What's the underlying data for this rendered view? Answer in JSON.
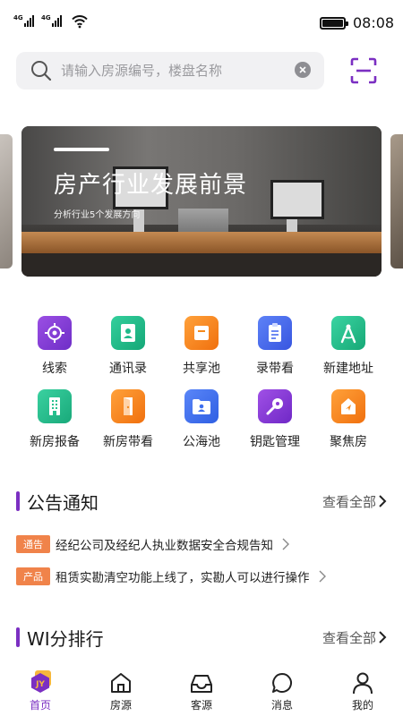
{
  "status_bar": {
    "signal_1": "4G",
    "signal_2": "4G",
    "time": "08:08"
  },
  "search": {
    "placeholder": "请输入房源编号，楼盘名称"
  },
  "banner": {
    "title": "房产行业发展前景",
    "subtitle": "分析行业5个发展方向"
  },
  "quick_actions": [
    {
      "label": "线索",
      "icon": "target-icon",
      "color": "#8a3ed6"
    },
    {
      "label": "通讯录",
      "icon": "contacts-icon",
      "color": "#1fb98a"
    },
    {
      "label": "共享池",
      "icon": "share-box-icon",
      "color": "#f5891f"
    },
    {
      "label": "录带看",
      "icon": "clipboard-icon",
      "color": "#4a6cf0"
    },
    {
      "label": "新建地址",
      "icon": "compass-icon",
      "color": "#22c08f"
    },
    {
      "label": "新房报备",
      "icon": "building-icon",
      "color": "#27c08e"
    },
    {
      "label": "新房带看",
      "icon": "door-icon",
      "color": "#f58a1c"
    },
    {
      "label": "公海池",
      "icon": "folder-user-icon",
      "color": "#3d6ff0"
    },
    {
      "label": "钥匙管理",
      "icon": "key-icon",
      "color": "#8b3ad6"
    },
    {
      "label": "聚焦房",
      "icon": "focus-house-icon",
      "color": "#f58a1c"
    }
  ],
  "announcements": {
    "title": "公告通知",
    "more": "查看全部",
    "items": [
      {
        "tag": "通告",
        "text": "经纪公司及经纪人执业数据安全合规告知"
      },
      {
        "tag": "产品",
        "text": "租赁实勘清空功能上线了，实勘人可以进行操作"
      }
    ]
  },
  "ranking": {
    "title": "WI分排行",
    "more": "查看全部"
  },
  "tabbar": [
    {
      "label": "首页",
      "icon": "home-logo-icon",
      "active": true,
      "logo_text": "JY"
    },
    {
      "label": "房源",
      "icon": "house-icon",
      "active": false
    },
    {
      "label": "客源",
      "icon": "inbox-icon",
      "active": false
    },
    {
      "label": "消息",
      "icon": "chat-bubble-icon",
      "active": false
    },
    {
      "label": "我的",
      "icon": "user-icon",
      "active": false
    }
  ],
  "colors": {
    "accent": "#7b2fc2",
    "tag": "#f0834a"
  }
}
